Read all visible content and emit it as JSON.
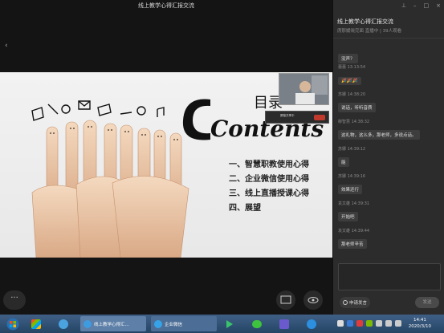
{
  "live": {
    "title": "线上教学心得汇报交流",
    "more_label": "···"
  },
  "slide": {
    "heading_script": "Contents",
    "heading_prefix": "目录",
    "items": [
      "一、智慧职教使用心得",
      "二、企业微信使用心得",
      "三、线上直播授课心得",
      "四、展望"
    ],
    "pip_badge": "屏幕共享中"
  },
  "chat": {
    "title": "线上教学心得汇报交流",
    "subtitle": "席那媛晓完面 直播中 | 39人观看",
    "messages": [
      {
        "name": "",
        "time": "",
        "text": "没声？"
      },
      {
        "name": "蕾蕾",
        "time": "13:13:54",
        "text": "🎉🎉🎉"
      },
      {
        "name": "苏娜",
        "time": "14:38:20",
        "text": "说话，听听音质"
      },
      {
        "name": "柳智慧",
        "time": "14:38:32",
        "text": "这礼物，这么多，那老师，多说点话。"
      },
      {
        "name": "苏娜",
        "time": "14:39:12",
        "text": "能"
      },
      {
        "name": "苏娜",
        "time": "14:39:16",
        "text": "效果还行"
      },
      {
        "name": "袁文雄",
        "time": "14:39:31",
        "text": "开始吧"
      },
      {
        "name": "袁文雄",
        "time": "14:39:44",
        "text": "那老师辛苦"
      }
    ],
    "apply_label": "申请发言",
    "send_label": "发送"
  },
  "taskbar": {
    "task1": "线上教学心得汇...",
    "task2": "企业微信",
    "time": "14:41",
    "date": "2020/3/10"
  }
}
